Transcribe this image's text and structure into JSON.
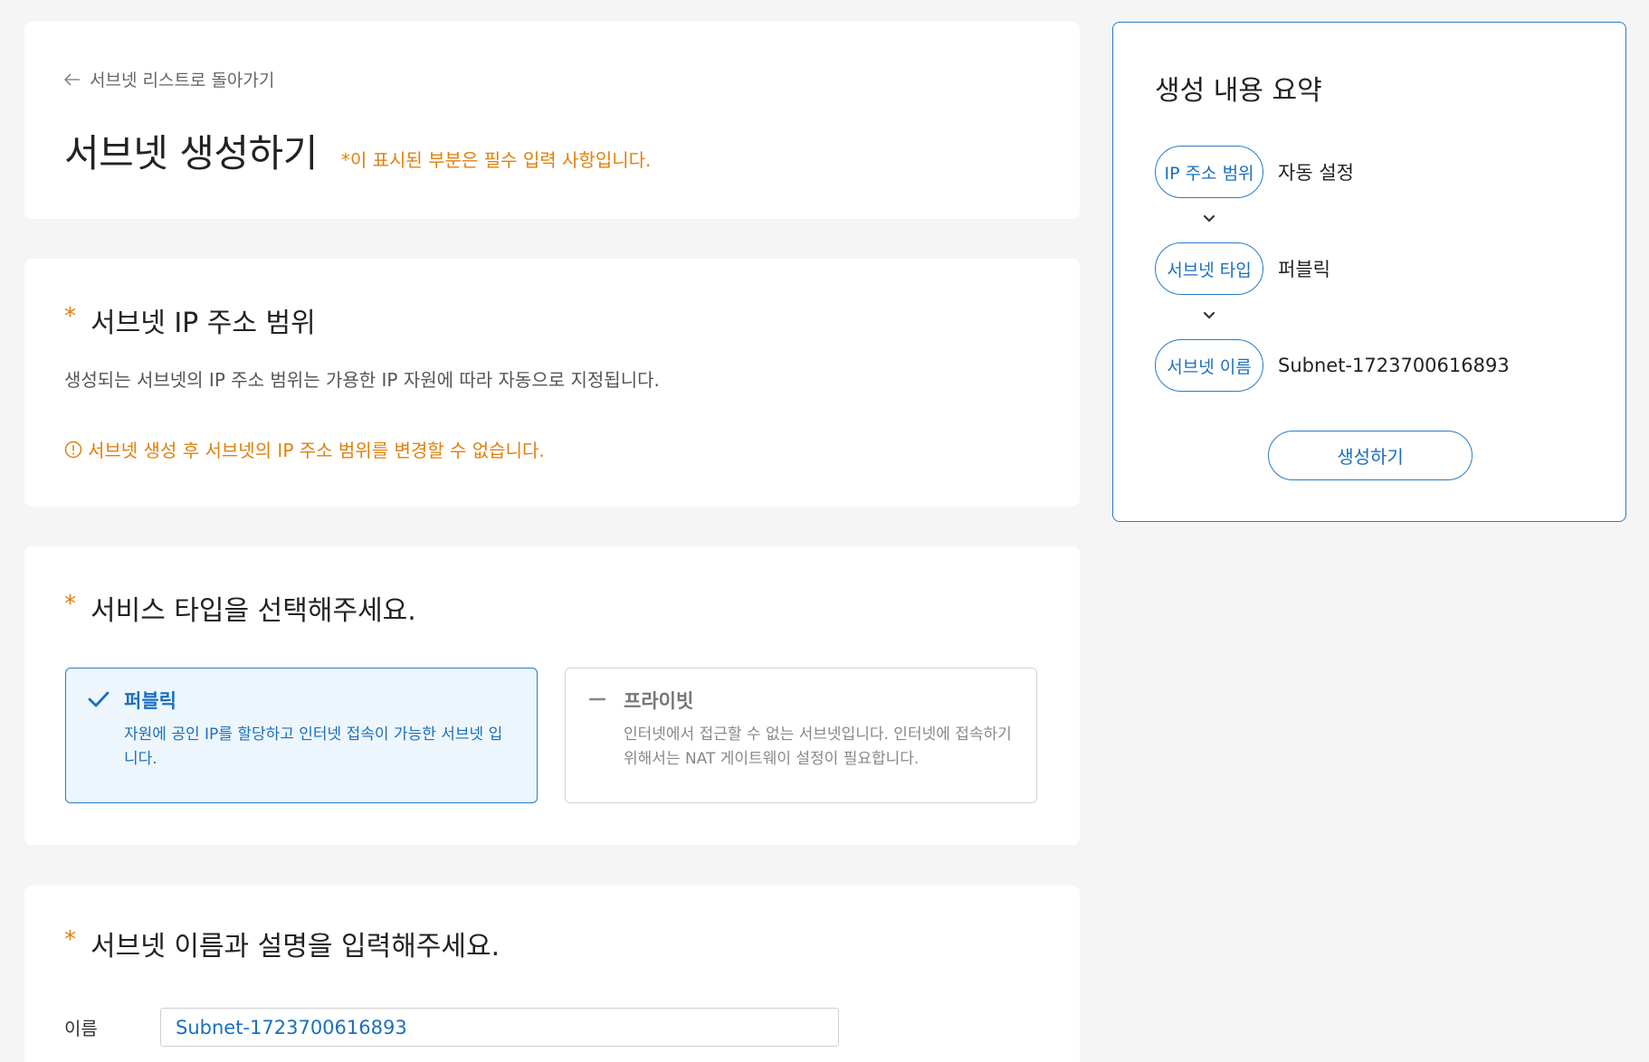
{
  "header": {
    "back_link": "서브넷 리스트로 돌아가기",
    "title": "서브넷 생성하기",
    "required_note": "*이 표시된 부분은 필수 입력 사항입니다."
  },
  "ip_section": {
    "star": "*",
    "title": "서브넷 IP 주소 범위",
    "description": "생성되는 서브넷의 IP 주소 범위는 가용한 IP 자원에 따라 자동으로 지정됩니다.",
    "warning": "서브넷 생성 후 서브넷의 IP 주소 범위를 변경할 수 없습니다."
  },
  "type_section": {
    "star": "*",
    "title": "서비스 타입을 선택해주세요.",
    "options": [
      {
        "title": "퍼블릭",
        "description": "자원에 공인 IP를 할당하고 인터넷 접속이 가능한 서브넷 입니다."
      },
      {
        "title": "프라이빗",
        "description": "인터넷에서 접근할 수 없는 서브넷입니다. 인터넷에 접속하기 위해서는 NAT 게이트웨이 설정이 필요합니다."
      }
    ]
  },
  "name_section": {
    "star": "*",
    "title": "서브넷 이름과 설명을 입력해주세요.",
    "name_label": "이름",
    "name_value": "Subnet-1723700616893"
  },
  "summary": {
    "title": "생성 내용 요약",
    "steps": [
      {
        "label": "IP 주소 범위",
        "value": "자동 설정"
      },
      {
        "label": "서브넷 타입",
        "value": "퍼블릭"
      },
      {
        "label": "서브넷 이름",
        "value": "Subnet-1723700616893"
      }
    ],
    "create_button": "생성하기"
  },
  "colors": {
    "accent": "#2a7bc4",
    "warning": "#e0800d",
    "background": "#f5f5f5"
  }
}
